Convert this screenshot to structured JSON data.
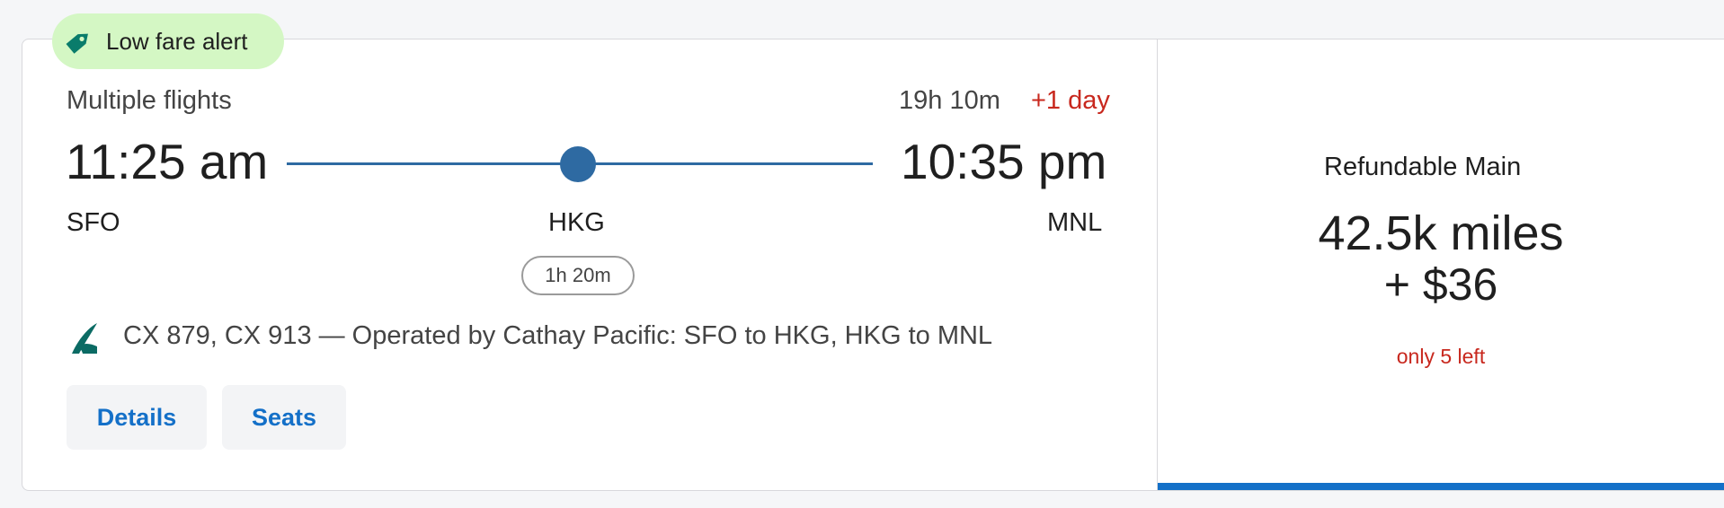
{
  "badge": {
    "label": "Low fare alert",
    "icon": "price-tag-icon",
    "bg_color": "#d4f7c4",
    "icon_color": "#0a7c6b"
  },
  "itinerary": {
    "flights_label": "Multiple flights",
    "duration": "19h 10m",
    "day_change": "+1 day",
    "departure_time": "11:25 am",
    "arrival_time": "10:35 pm",
    "origin": "SFO",
    "stop": "HKG",
    "destination": "MNL",
    "layover": "1h 20m",
    "airline_icon": "cathay-pacific-logo-icon",
    "flight_info": "CX 879, CX 913 — Operated by Cathay Pacific: SFO to HKG, HKG to MNL"
  },
  "actions": {
    "details_label": "Details",
    "seats_label": "Seats"
  },
  "fare": {
    "name": "Refundable Main",
    "miles": "42.5k miles",
    "cash": "+ $36",
    "availability": "only 5 left"
  },
  "colors": {
    "accent": "#1470c8",
    "route": "#2e6aa2",
    "alert": "#c8281e"
  }
}
